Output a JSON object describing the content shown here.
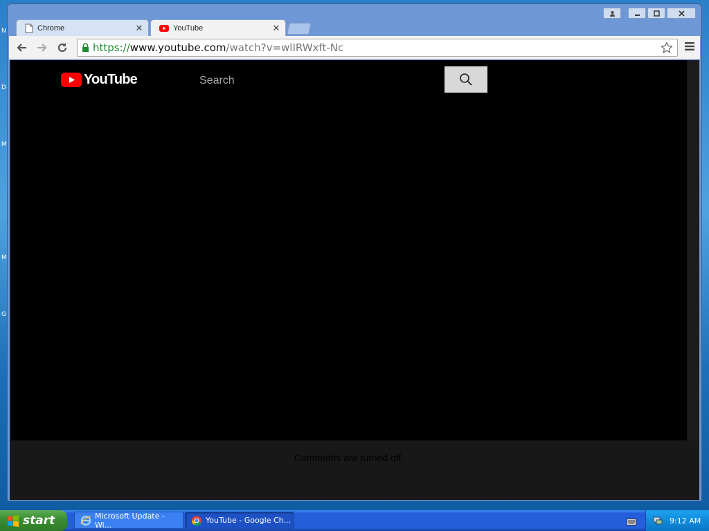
{
  "desktop": {
    "edge_letters": [
      "D",
      "M",
      "M",
      "G",
      "N"
    ]
  },
  "browser": {
    "tabs": [
      {
        "label": "Chrome",
        "icon": "page-icon",
        "active": false
      },
      {
        "label": "YouTube",
        "icon": "youtube-icon",
        "active": true
      }
    ],
    "window_buttons": [
      "user",
      "minimize",
      "maximize",
      "close"
    ],
    "address": {
      "scheme": "https://",
      "host": "www.youtube.com",
      "path": "/watch?v=wlIRWxft-Nc"
    }
  },
  "youtube": {
    "logo_text": "YouTube",
    "search_placeholder": "Search",
    "comments_message": "Comments are turned off."
  },
  "taskbar": {
    "start_label": "start",
    "tasks": [
      {
        "label": "Microsoft Update - Wi...",
        "icon": "internet-explorer-icon",
        "active": false
      },
      {
        "label": "YouTube - Google Ch...",
        "icon": "chrome-icon",
        "active": true
      }
    ],
    "clock": "9:12 AM"
  },
  "colors": {
    "youtube_red": "#ff0000",
    "secure_green": "#1e8a2e",
    "taskbar_blue": "#245edb",
    "start_green": "#3c8f34"
  }
}
